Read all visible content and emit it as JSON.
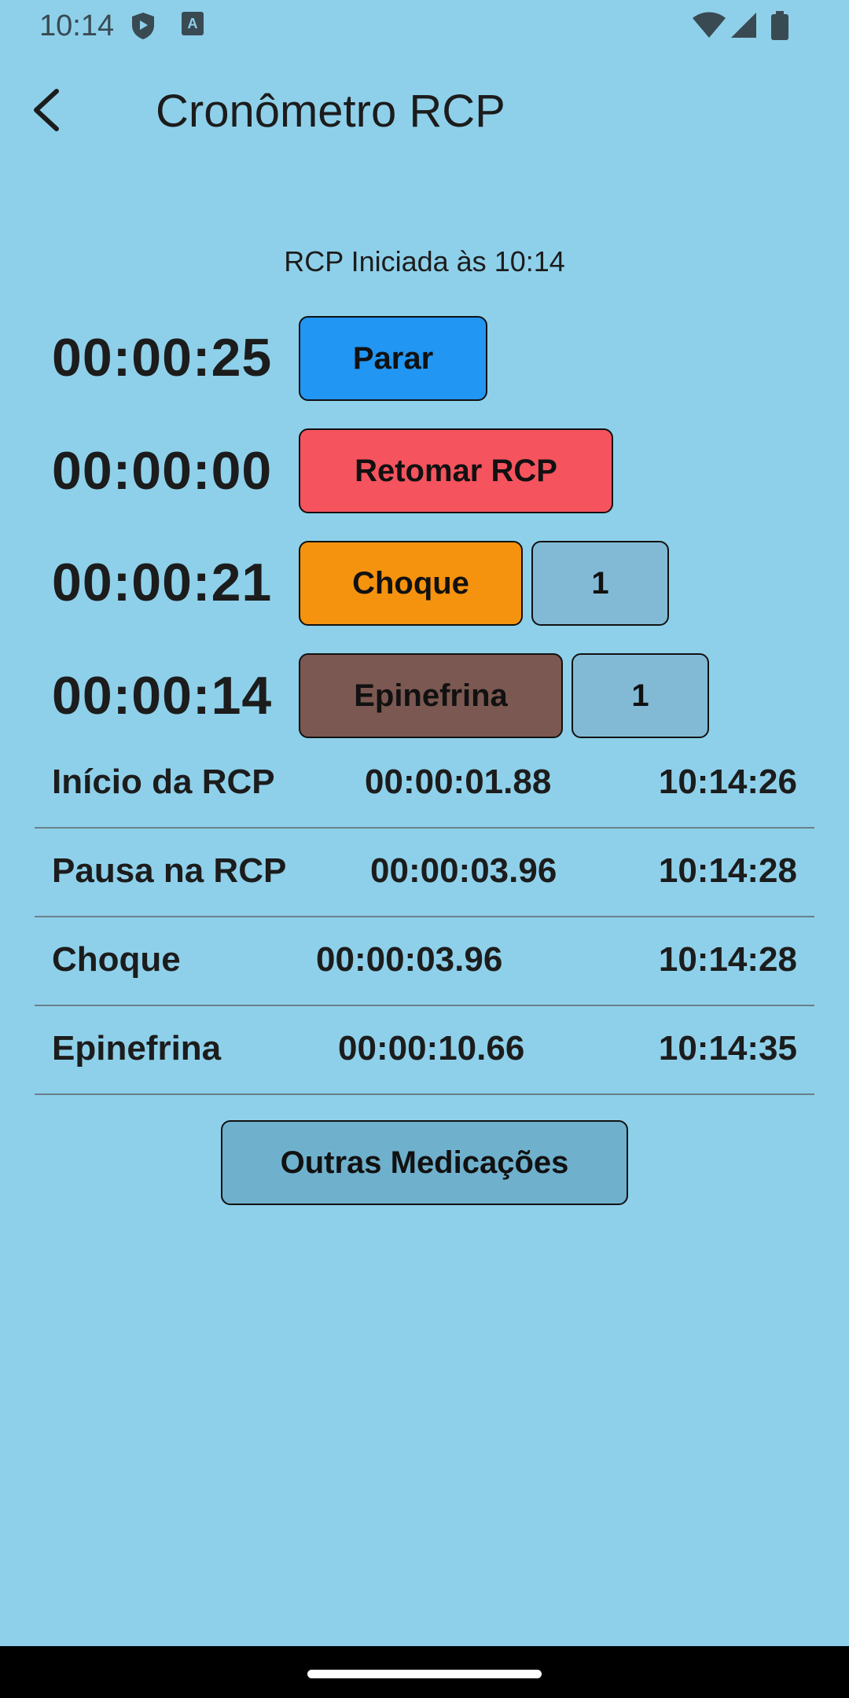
{
  "status_bar": {
    "time": "10:14",
    "icons": [
      "shield-icon",
      "keyboard-a-icon",
      "wifi-icon",
      "signal-icon",
      "battery-icon"
    ]
  },
  "app_bar": {
    "title": "Cronômetro RCP",
    "back_icon": "chevron-left-icon"
  },
  "subtitle": "RCP Iniciada às 10:14",
  "timers": [
    {
      "value": "00:00:25",
      "button_label": "Parar",
      "button_color": "#2196f3"
    },
    {
      "value": "00:00:00",
      "button_label": "Retomar RCP",
      "button_color": "#f5535e"
    },
    {
      "value": "00:00:21",
      "button_label": "Choque",
      "button_color": "#f5920e",
      "count": "1"
    },
    {
      "value": "00:00:14",
      "button_label": "Epinefrina",
      "button_color": "#7b5851",
      "count": "1"
    }
  ],
  "log": [
    {
      "label": "Início da RCP",
      "elapsed": "00:00:01.88",
      "time": "10:14:26"
    },
    {
      "label": "Pausa na RCP",
      "elapsed": "00:00:03.96",
      "time": "10:14:28"
    },
    {
      "label": "Choque",
      "elapsed": "00:00:03.96",
      "time": "10:14:28"
    },
    {
      "label": "Epinefrina",
      "elapsed": "00:00:10.66",
      "time": "10:14:35"
    }
  ],
  "other_meds_button": "Outras Medicações",
  "colors": {
    "background": "#8ed0ea",
    "count_button": "#82bad6",
    "other_meds_button": "#6fb0cc"
  }
}
